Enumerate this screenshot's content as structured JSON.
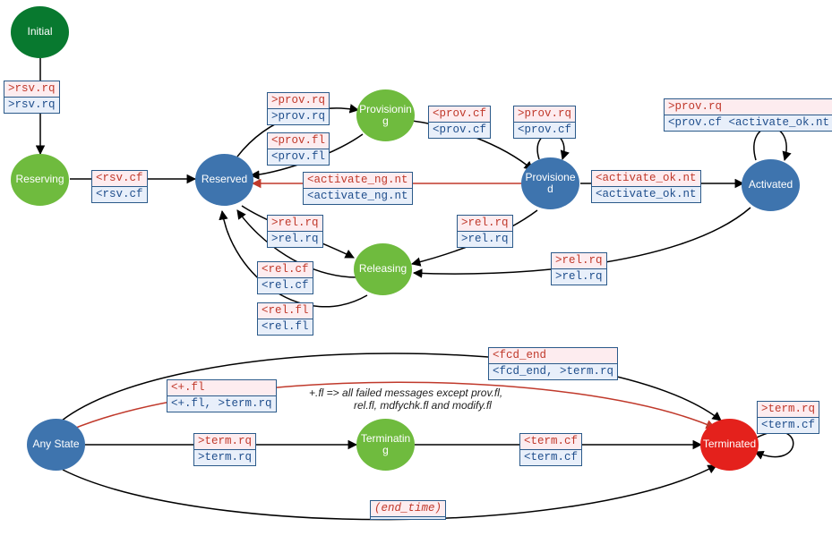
{
  "states": {
    "initial": "Initial",
    "reserving": "Reserving",
    "reserved": "Reserved",
    "provisioning": "Provisioning",
    "provisioned": "Provisioned",
    "activated": "Activated",
    "releasing": "Releasing",
    "any": "Any State",
    "terminating": "Terminating",
    "terminated": "Terminated"
  },
  "msgs": {
    "rsv_rq": [
      ">rsv.rq",
      ">rsv.rq"
    ],
    "rsv_cf": [
      "<rsv.cf",
      "<rsv.cf"
    ],
    "prov_rq": [
      ">prov.rq",
      ">prov.rq"
    ],
    "prov_fl": [
      "<prov.fl",
      "<prov.fl"
    ],
    "prov_cf": [
      "<prov.cf",
      "<prov.cf"
    ],
    "prov_self": [
      ">prov.rq",
      "<prov.cf"
    ],
    "activate_ok": [
      "<activate_ok.nt",
      "<activate_ok.nt"
    ],
    "activated_self": [
      ">prov.rq",
      "<prov.cf <activate_ok.nt"
    ],
    "activate_ng": [
      "<activate_ng.nt",
      "<activate_ng.nt"
    ],
    "rel_rq": [
      ">rel.rq",
      ">rel.rq"
    ],
    "rel_rq2": [
      ">rel.rq",
      ">rel.rq"
    ],
    "rel_rq3": [
      ">rel.rq",
      ">rel.rq"
    ],
    "rel_cf": [
      "<rel.cf",
      "<rel.cf"
    ],
    "rel_fl": [
      "<rel.fl",
      "<rel.fl"
    ],
    "fcd_end": [
      "<fcd_end",
      "<fcd_end, >term.rq"
    ],
    "plus_fl": [
      "<+.fl",
      "<+.fl, >term.rq"
    ],
    "term_rq": [
      ">term.rq",
      ">term.rq"
    ],
    "term_cf": [
      "<term.cf",
      "<term.cf"
    ],
    "term_self": [
      ">term.rq",
      "<term.cf"
    ],
    "end_time": [
      "(end_time)",
      " "
    ]
  },
  "note": {
    "line1": "+.fl => all failed messages except prov.fl,",
    "line2": "rel.fl, mdfychk.fl and modify.fl"
  },
  "chart_data": {
    "type": "state_diagram",
    "states": [
      {
        "id": "Initial",
        "kind": "start"
      },
      {
        "id": "Reserving",
        "kind": "transient"
      },
      {
        "id": "Reserved",
        "kind": "stable"
      },
      {
        "id": "Provisioning",
        "kind": "transient"
      },
      {
        "id": "Provisioned",
        "kind": "stable"
      },
      {
        "id": "Activated",
        "kind": "stable"
      },
      {
        "id": "Releasing",
        "kind": "transient"
      },
      {
        "id": "Any State",
        "kind": "pseudo"
      },
      {
        "id": "Terminating",
        "kind": "transient"
      },
      {
        "id": "Terminated",
        "kind": "final"
      }
    ],
    "transitions": [
      {
        "from": "Initial",
        "to": "Reserving",
        "trigger": ">rsv.rq",
        "action": ">rsv.rq"
      },
      {
        "from": "Reserving",
        "to": "Reserved",
        "trigger": "<rsv.cf",
        "action": "<rsv.cf"
      },
      {
        "from": "Reserved",
        "to": "Provisioning",
        "trigger": ">prov.rq",
        "action": ">prov.rq"
      },
      {
        "from": "Provisioning",
        "to": "Reserved",
        "trigger": "<prov.fl",
        "action": "<prov.fl"
      },
      {
        "from": "Provisioning",
        "to": "Provisioned",
        "trigger": "<prov.cf",
        "action": "<prov.cf"
      },
      {
        "from": "Provisioned",
        "to": "Provisioned",
        "trigger": ">prov.rq",
        "action": "<prov.cf"
      },
      {
        "from": "Provisioned",
        "to": "Activated",
        "trigger": "<activate_ok.nt",
        "action": "<activate_ok.nt"
      },
      {
        "from": "Activated",
        "to": "Activated",
        "trigger": ">prov.rq",
        "action": "<prov.cf <activate_ok.nt"
      },
      {
        "from": "Provisioned",
        "to": "Reserved",
        "trigger": "<activate_ng.nt",
        "action": "<activate_ng.nt",
        "error": true
      },
      {
        "from": "Reserved",
        "to": "Releasing",
        "trigger": ">rel.rq",
        "action": ">rel.rq"
      },
      {
        "from": "Provisioned",
        "to": "Releasing",
        "trigger": ">rel.rq",
        "action": ">rel.rq"
      },
      {
        "from": "Activated",
        "to": "Releasing",
        "trigger": ">rel.rq",
        "action": ">rel.rq"
      },
      {
        "from": "Releasing",
        "to": "Reserved",
        "trigger": "<rel.cf",
        "action": "<rel.cf"
      },
      {
        "from": "Releasing",
        "to": "Reserved",
        "trigger": "<rel.fl",
        "action": "<rel.fl"
      },
      {
        "from": "Any State",
        "to": "Terminated",
        "trigger": "<fcd_end",
        "action": "<fcd_end, >term.rq"
      },
      {
        "from": "Any State",
        "to": "Terminated",
        "trigger": "<+.fl",
        "action": "<+.fl, >term.rq",
        "error": true
      },
      {
        "from": "Any State",
        "to": "Terminating",
        "trigger": ">term.rq",
        "action": ">term.rq"
      },
      {
        "from": "Terminating",
        "to": "Terminated",
        "trigger": "<term.cf",
        "action": "<term.cf"
      },
      {
        "from": "Any State",
        "to": "Terminated",
        "trigger": "(end_time)",
        "action": ""
      },
      {
        "from": "Terminated",
        "to": "Terminated",
        "trigger": ">term.rq",
        "action": "<term.cf"
      }
    ],
    "note": "+.fl => all failed messages except prov.fl, rel.fl, mdfychk.fl and modify.fl"
  }
}
